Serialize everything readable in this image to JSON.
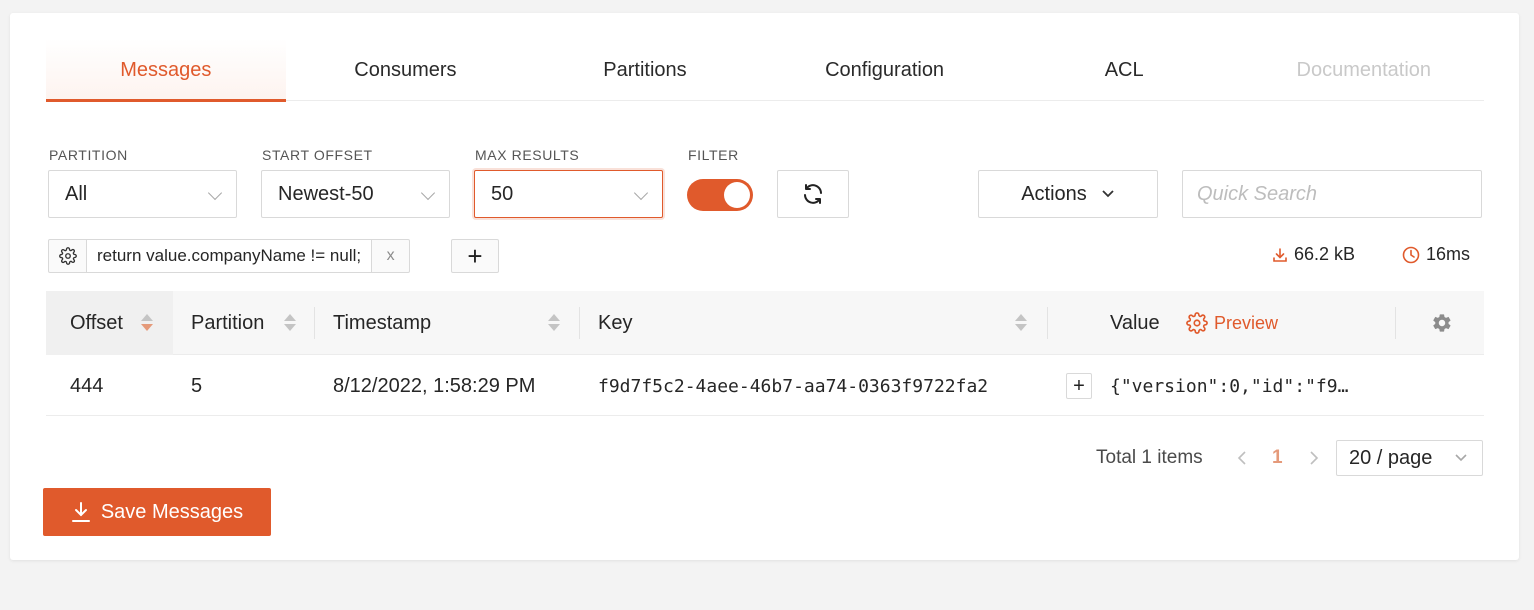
{
  "tabs": [
    {
      "label": "Messages",
      "active": true
    },
    {
      "label": "Consumers"
    },
    {
      "label": "Partitions"
    },
    {
      "label": "Configuration"
    },
    {
      "label": "ACL"
    },
    {
      "label": "Documentation",
      "disabled": true
    }
  ],
  "filters": {
    "partition": {
      "label": "PARTITION",
      "value": "All"
    },
    "start_offset": {
      "label": "START OFFSET",
      "value": "Newest-50"
    },
    "max_results": {
      "label": "MAX RESULTS",
      "value": "50"
    },
    "filter": {
      "label": "FILTER",
      "enabled": true
    },
    "actions_label": "Actions",
    "search_placeholder": "Quick Search"
  },
  "js_filter": {
    "code": "return value.companyName != null;",
    "remove": "x",
    "add": "+"
  },
  "stats": {
    "size": "66.2 kB",
    "time": "16ms"
  },
  "table": {
    "columns": [
      "Offset",
      "Partition",
      "Timestamp",
      "Key",
      "Value"
    ],
    "preview_label": "Preview",
    "rows": [
      {
        "offset": "444",
        "partition": "5",
        "timestamp": "8/12/2022, 1:58:29 PM",
        "key": "f9d7f5c2-4aee-46b7-aa74-0363f9722fa2",
        "value": "{\"version\":0,\"id\":\"f9…",
        "expand": "+"
      }
    ]
  },
  "pagination": {
    "total": "Total 1 items",
    "current_page": "1",
    "page_size": "20 / page"
  },
  "save_label": "Save Messages",
  "colors": {
    "accent": "#e05a2c"
  }
}
